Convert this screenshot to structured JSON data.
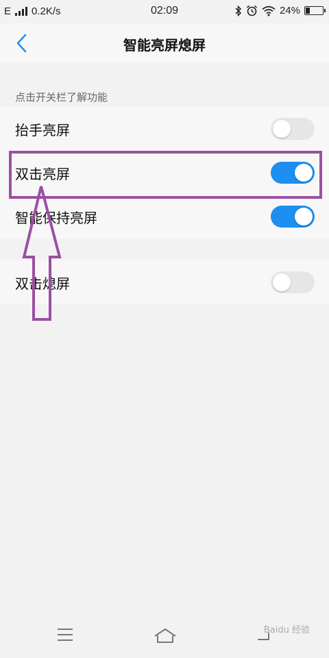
{
  "status_bar": {
    "network_type": "E",
    "speed": "0.2K/s",
    "time": "02:09",
    "battery_percent": "24%",
    "battery_level": 0.24,
    "icons": [
      "signal-icon",
      "bluetooth-icon",
      "alarm-icon",
      "wifi-icon",
      "battery-icon"
    ]
  },
  "header": {
    "title": "智能亮屏熄屏",
    "back_icon": "chevron-left-icon"
  },
  "section_hint": "点击开关栏了解功能",
  "settings_group_1": [
    {
      "label": "抬手亮屏",
      "enabled": false
    },
    {
      "label": "双击亮屏",
      "enabled": true
    },
    {
      "label": "智能保持亮屏",
      "enabled": true
    }
  ],
  "settings_group_2": [
    {
      "label": "双击熄屏",
      "enabled": false
    }
  ],
  "annotation": {
    "highlight_color": "#9b4fa3",
    "arrow_color": "#9b4fa3",
    "highlighted_item": "双击亮屏"
  },
  "colors": {
    "accent": "#1d8ff0",
    "toggle_off": "#e6e6e6",
    "back_icon": "#1d8ff0"
  },
  "nav_bar": {
    "icons": [
      "menu-icon",
      "home-icon",
      "back-icon"
    ]
  },
  "watermark": "Baidu 经验"
}
